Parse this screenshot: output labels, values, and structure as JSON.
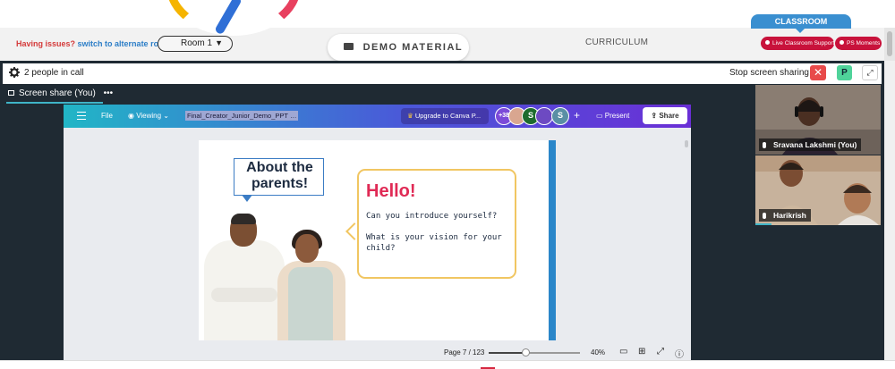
{
  "header": {
    "issues_prefix": "Having issues?",
    "issues_link": "switch to alternate room",
    "room_select": {
      "value": "Room 1"
    },
    "demo_button": "DEMO MATERIAL",
    "curriculum": "CURRICULUM",
    "classroom_tab": "CLASSROOM",
    "live_support": "Live Classroom Support",
    "ps_moments": "PS Moments"
  },
  "callbar": {
    "people_count": "2 people in call",
    "stop_sharing": "Stop screen sharing",
    "close_label": "✕",
    "p_label": "P",
    "expand_label": "⤢"
  },
  "stage": {
    "share_label": "Screen share (You)",
    "share_menu": "•••"
  },
  "canva": {
    "file": "File",
    "viewing": "Viewing",
    "doc_title": "Final_Creator_Junior_Demo_PPT",
    "doc_title_suffix": "…",
    "upgrade": "Upgrade to Canva P...",
    "avatars": [
      {
        "label": "+38",
        "color": "#7c4ad8"
      },
      {
        "label": "",
        "color": "#d9a690"
      },
      {
        "label": "S",
        "color": "#1e6b2e"
      },
      {
        "label": "",
        "color": "#6d4ac2"
      },
      {
        "label": "S",
        "color": "#5a8fa5"
      }
    ],
    "plus": "+",
    "present": "Present",
    "share": "Share",
    "page": "Page 7 / 123",
    "zoom": "40%",
    "zoom_fraction": 0.4,
    "icons": [
      "notes-icon",
      "grid-icon",
      "fullscreen-icon",
      "help-icon"
    ]
  },
  "slide": {
    "about_line1": "About the",
    "about_line2": "parents!",
    "hello": "Hello!",
    "question1": "Can you introduce yourself?",
    "question2": "What is your vision for your child?"
  },
  "tiles": [
    {
      "name": "Sravana Lakshmi (You)"
    },
    {
      "name": "Harikrish"
    }
  ],
  "colors": {
    "accent_red": "#c8123b",
    "classroom_blue": "#3a8fd0",
    "stage_dark": "#1f2a33",
    "canva_gradient_start": "#21b6c6",
    "canva_gradient_end": "#6a2fd6",
    "hello_pink": "#e02a55"
  }
}
